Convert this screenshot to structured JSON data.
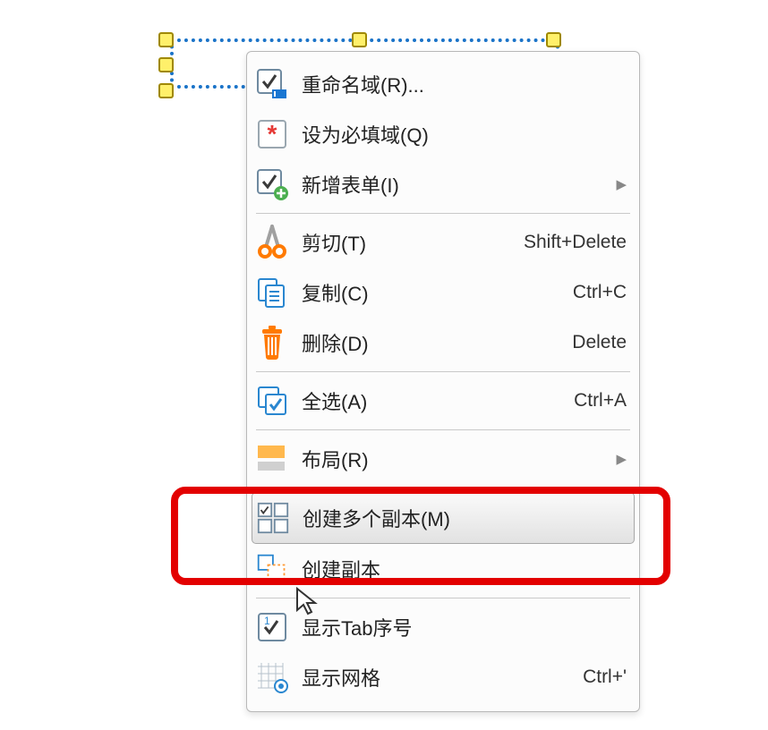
{
  "menu": {
    "rename_label": "重命名域(R)...",
    "required_label": "设为必填域(Q)",
    "newform_label": "新增表单(I)",
    "cut_label": "剪切(T)",
    "cut_shortcut": "Shift+Delete",
    "copy_label": "复制(C)",
    "copy_shortcut": "Ctrl+C",
    "delete_label": "删除(D)",
    "delete_shortcut": "Delete",
    "selectall_label": "全选(A)",
    "selectall_shortcut": "Ctrl+A",
    "layout_label": "布局(R)",
    "createmulti_label": "创建多个副本(M)",
    "createcopy_label": "创建副本",
    "showtab_label": "显示Tab序号",
    "showgrid_label": "显示网格",
    "showgrid_shortcut": "Ctrl+'"
  }
}
